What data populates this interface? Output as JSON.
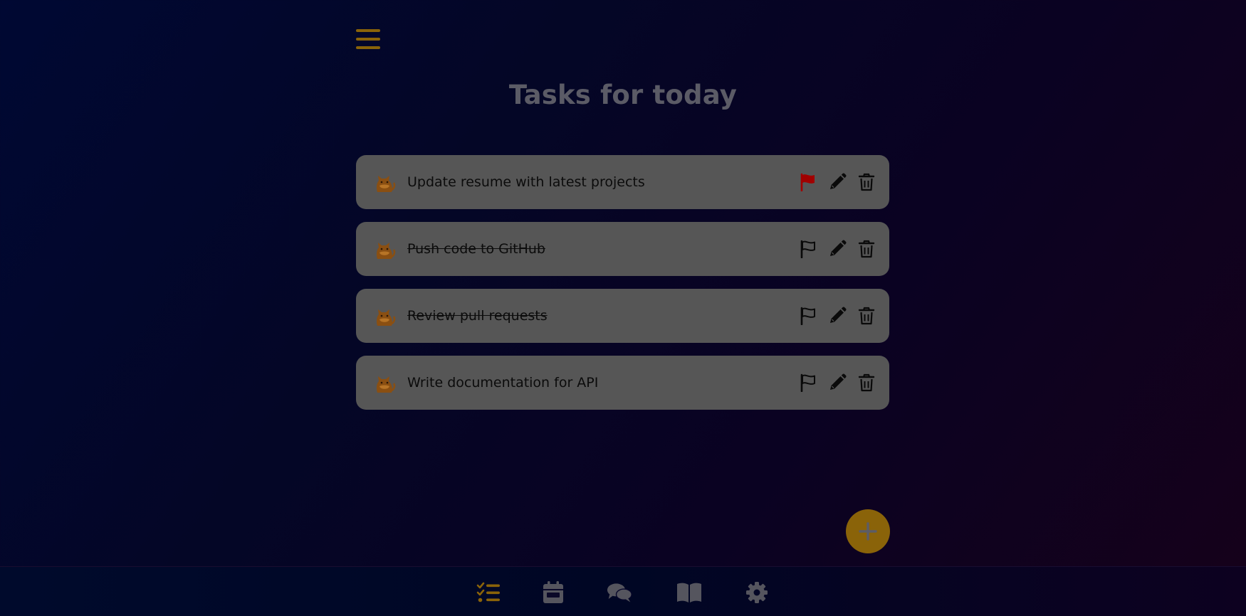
{
  "header": {
    "menu_icon": "hamburger-menu-icon",
    "title": "Tasks for today"
  },
  "tasks": [
    {
      "text": "Update resume with latest projects",
      "completed": false,
      "flagged": true
    },
    {
      "text": "Push code to GitHub",
      "completed": true,
      "flagged": false
    },
    {
      "text": "Review pull requests",
      "completed": true,
      "flagged": false
    },
    {
      "text": "Write documentation for API",
      "completed": false,
      "flagged": false
    }
  ],
  "task_icons": {
    "avatar": "cat-icon",
    "flag": "flag-icon",
    "edit": "pencil-icon",
    "delete": "trash-icon"
  },
  "fab": {
    "icon": "plus-icon"
  },
  "bottom_nav": {
    "items": [
      {
        "icon": "tasks-list-icon",
        "active": true
      },
      {
        "icon": "calendar-icon",
        "active": false
      },
      {
        "icon": "chat-icon",
        "active": false
      },
      {
        "icon": "book-icon",
        "active": false
      },
      {
        "icon": "gear-icon",
        "active": false
      }
    ]
  },
  "colors": {
    "accent": "#8a6309",
    "flag_active": "#a10000",
    "card_background": "#565656",
    "title_text": "#5b5b66",
    "nav_icon": "#55555e"
  }
}
